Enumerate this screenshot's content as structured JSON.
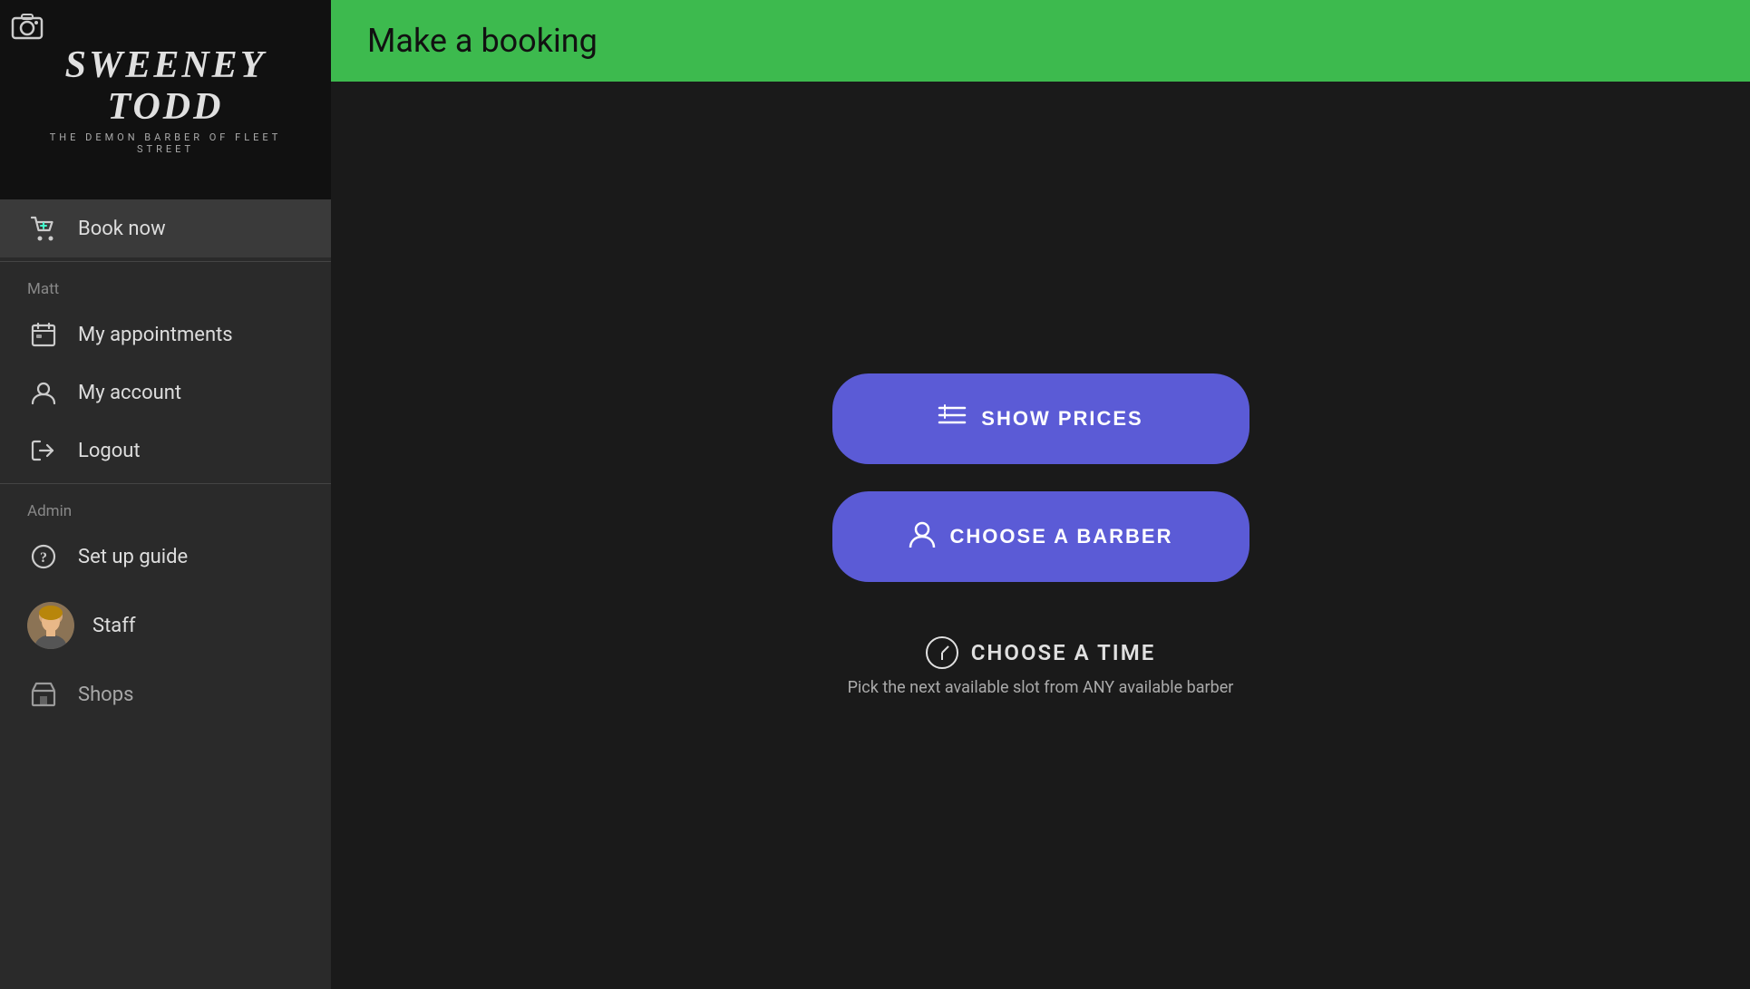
{
  "sidebar": {
    "logo": {
      "main": "Sweeney Todd",
      "sub": "The Demon Barber of Fleet Street"
    },
    "nav": {
      "book_now_label": "Book now",
      "section_user_label": "Matt",
      "my_appointments_label": "My appointments",
      "my_account_label": "My account",
      "logout_label": "Logout",
      "section_admin_label": "Admin",
      "set_up_guide_label": "Set up guide",
      "staff_label": "Staff",
      "shops_label": "Shops"
    }
  },
  "topbar": {
    "title": "Make a booking"
  },
  "main": {
    "show_prices_label": "SHOW PRICES",
    "choose_barber_label": "CHOOSE A BARBER",
    "choose_time_label": "CHOOSE A TIME",
    "choose_time_subtitle": "Pick the next available slot from ANY available barber",
    "accent_color": "#5b5bd6",
    "green_color": "#3dba4e"
  }
}
